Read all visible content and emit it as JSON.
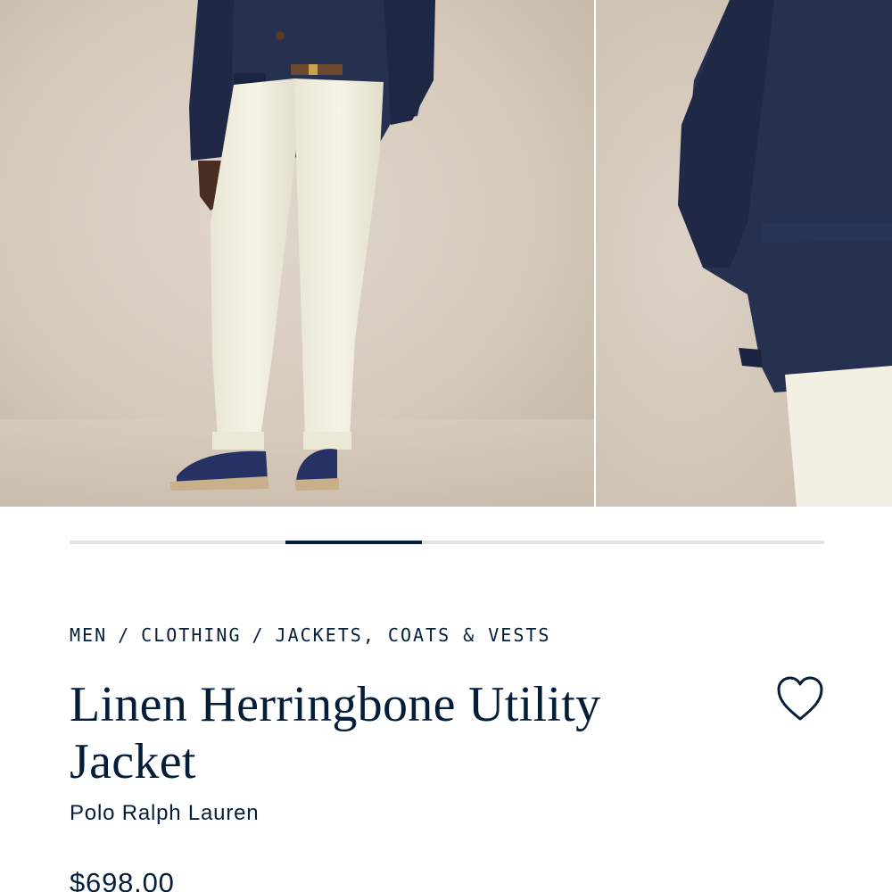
{
  "carousel": {
    "images": [
      {
        "alt": "full-length model view"
      },
      {
        "alt": "jacket back detail view"
      }
    ],
    "progress": {
      "segments": 4,
      "active_index": 1
    }
  },
  "breadcrumb": {
    "items": [
      "MEN",
      "CLOTHING",
      "JACKETS, COATS & VESTS"
    ],
    "separator": "/"
  },
  "product": {
    "title": "Linen Herringbone Utility Jacket",
    "brand": "Polo Ralph Lauren",
    "price": "$698.00"
  },
  "wishlist": {
    "icon": "heart-outline-icon"
  },
  "colors": {
    "navy": "#041e3a",
    "track": "#e3e3e6",
    "backdrop": "#d9cec2"
  }
}
